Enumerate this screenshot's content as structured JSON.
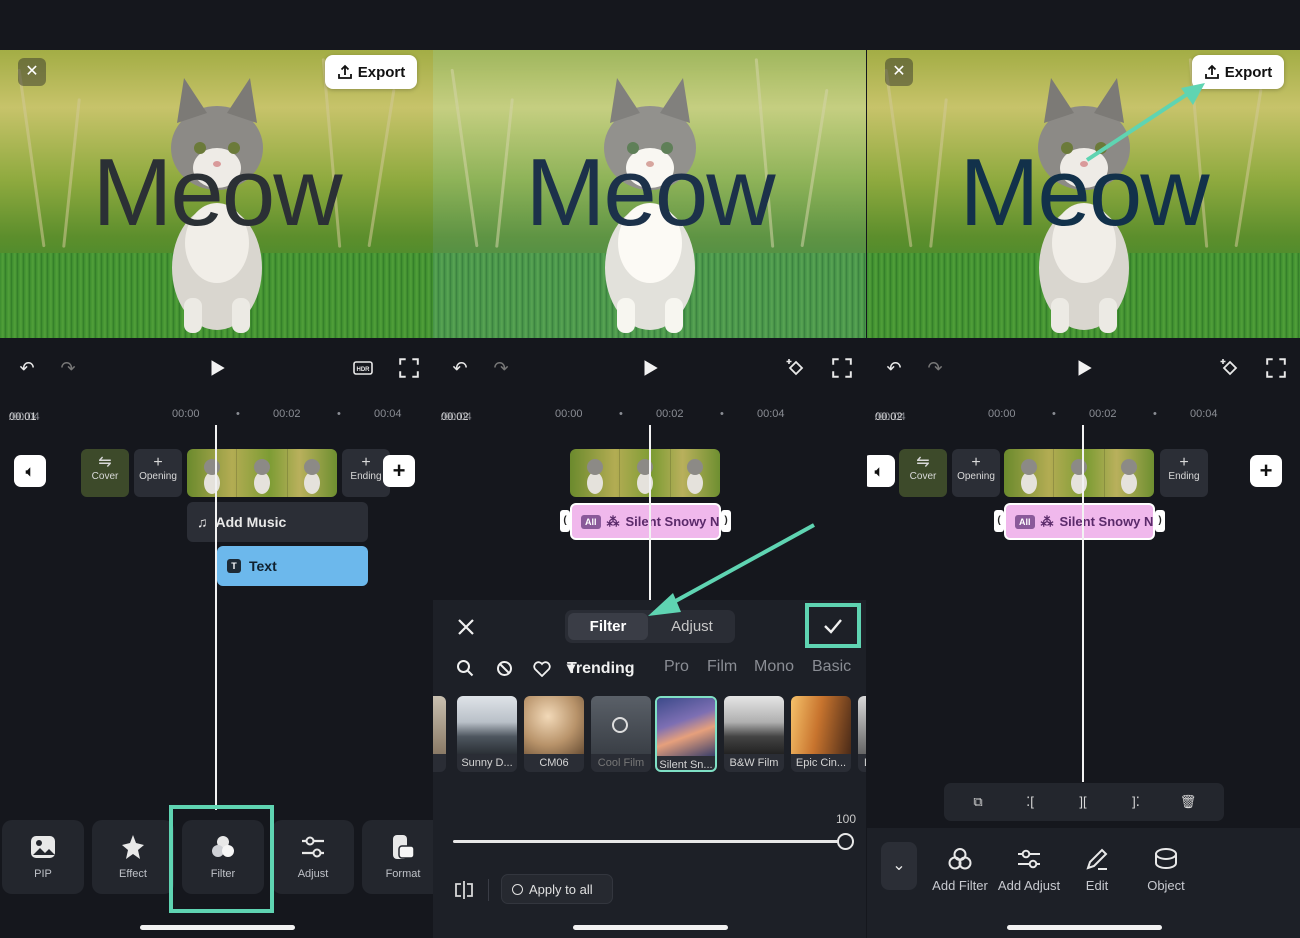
{
  "preview": {
    "overlay_text": "Meow",
    "export_label": "Export",
    "close_symbol": "✕"
  },
  "screen1": {
    "time_current": "00:01",
    "time_total": "/00:04",
    "ruler_ticks": [
      "00:00",
      "00:02",
      "00:04"
    ],
    "cover_label": "Cover",
    "opening_label": "Opening",
    "ending_label": "Ending",
    "music_track_label": "Add Music",
    "text_track_label": "Text",
    "tools": [
      {
        "label": "PIP",
        "icon": "image-icon"
      },
      {
        "label": "Effect",
        "icon": "sparkle-icon"
      },
      {
        "label": "Filter",
        "icon": "filter-icon"
      },
      {
        "label": "Adjust",
        "icon": "sliders-icon"
      },
      {
        "label": "Format",
        "icon": "format-icon"
      }
    ]
  },
  "screen2": {
    "time_current": "00:02",
    "time_total": "/00:04",
    "ruler_ticks": [
      "00:00",
      "00:02",
      "00:04"
    ],
    "filter_track": {
      "tag": "All",
      "name": "Silent Snowy N"
    },
    "tabs": [
      {
        "label": "Filter",
        "active": true
      },
      {
        "label": "Adjust",
        "active": false
      }
    ],
    "categories": [
      "Trending",
      "Pro",
      "Film",
      "Mono",
      "Basic"
    ],
    "active_category": "Trending",
    "filters": [
      {
        "label": "Sunny D...",
        "selected": false
      },
      {
        "label": "CM06",
        "selected": false
      },
      {
        "label": "Cool Film",
        "selected": false
      },
      {
        "label": "Silent Sn...",
        "selected": true
      },
      {
        "label": "B&W Film",
        "selected": false
      },
      {
        "label": "Epic Cin...",
        "selected": false
      },
      {
        "label": "D",
        "selected": false
      }
    ],
    "intensity_value": "100",
    "intensity_fraction": 1.0,
    "apply_all_label": "Apply to all"
  },
  "screen3": {
    "time_current": "00:02",
    "time_total": "/00:04",
    "ruler_ticks": [
      "00:00",
      "00:02",
      "00:04"
    ],
    "cover_label": "Cover",
    "opening_label": "Opening",
    "ending_label": "Ending",
    "filter_track": {
      "tag": "All",
      "name": "Silent Snowy N"
    },
    "actions": [
      {
        "label": "Add Filter",
        "icon": "filter-icon"
      },
      {
        "label": "Add Adjust",
        "icon": "sliders-icon"
      },
      {
        "label": "Edit",
        "icon": "pencil-icon"
      },
      {
        "label": "Object",
        "icon": "object-icon"
      }
    ]
  },
  "colors": {
    "background": "#15171d",
    "highlight": "#5fd4b2",
    "filter_track": "#f0b8ec",
    "text_track": "#6cb8ec"
  }
}
